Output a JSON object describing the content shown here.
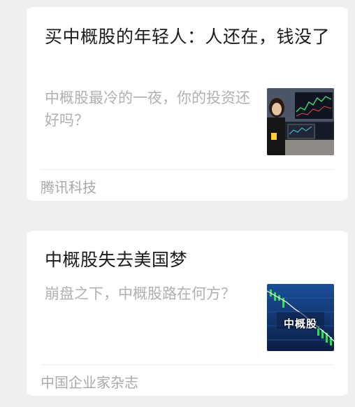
{
  "articles": [
    {
      "title": "买中概股的年轻人：人还在，钱没了",
      "summary": "中概股最冷的一夜，你的投资还好吗？",
      "source": "腾讯科技"
    },
    {
      "title": "中概股失去美国梦",
      "summary": "崩盘之下，中概股路在何方？",
      "source": "中国企业家杂志",
      "thumbnail_text": "中概股"
    }
  ]
}
